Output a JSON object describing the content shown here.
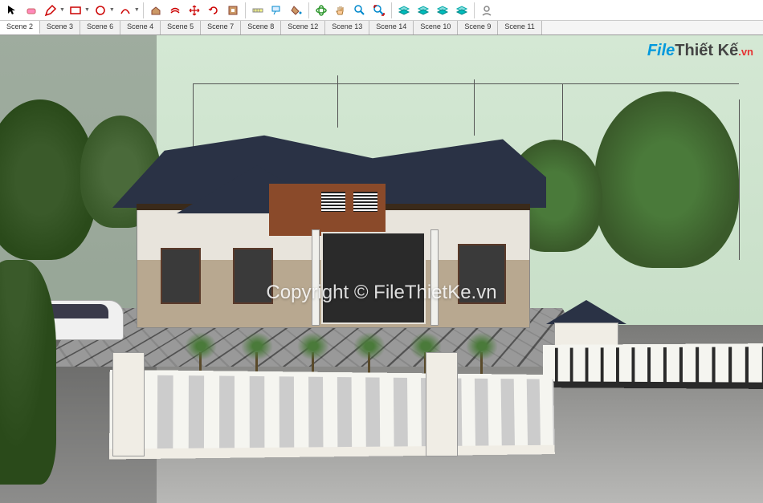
{
  "toolbar": {
    "tools": [
      {
        "name": "select-tool",
        "color": "#000"
      },
      {
        "name": "eraser-tool",
        "color": "#e88"
      },
      {
        "name": "pencil-tool",
        "color": "#c00",
        "hasDropdown": true
      },
      {
        "name": "rectangle-tool",
        "color": "#c00",
        "hasDropdown": true
      },
      {
        "name": "circle-tool",
        "color": "#c00",
        "hasDropdown": true
      },
      {
        "name": "arc-tool",
        "color": "#c00",
        "hasDropdown": true
      }
    ],
    "tools2": [
      {
        "name": "push-pull-tool",
        "color": "#a33"
      },
      {
        "name": "offset-tool",
        "color": "#c00"
      },
      {
        "name": "move-tool",
        "color": "#c00"
      },
      {
        "name": "rotate-tool",
        "color": "#c00"
      },
      {
        "name": "scale-tool",
        "color": "#a33"
      }
    ],
    "tools3": [
      {
        "name": "tape-measure-tool",
        "color": "#888"
      },
      {
        "name": "text-tool",
        "color": "#08c"
      },
      {
        "name": "paint-bucket-tool",
        "color": "#a73"
      }
    ],
    "tools4": [
      {
        "name": "orbit-tool",
        "color": "#393"
      },
      {
        "name": "pan-tool",
        "color": "#a73"
      },
      {
        "name": "zoom-tool",
        "color": "#08c"
      },
      {
        "name": "zoom-extents-tool",
        "color": "#c00"
      }
    ],
    "tools5": [
      {
        "name": "layer-tool-1",
        "color": "#0bb"
      },
      {
        "name": "layer-tool-2",
        "color": "#0bb"
      },
      {
        "name": "layer-tool-3",
        "color": "#0bb"
      },
      {
        "name": "layer-tool-4",
        "color": "#0bb"
      }
    ],
    "tools6": [
      {
        "name": "profile-tool",
        "color": "#888"
      }
    ]
  },
  "scenes": {
    "tabs": [
      {
        "label": "Scene 2",
        "active": true
      },
      {
        "label": "Scene 3",
        "active": false
      },
      {
        "label": "Scene 6",
        "active": false
      },
      {
        "label": "Scene 4",
        "active": false
      },
      {
        "label": "Scene 5",
        "active": false
      },
      {
        "label": "Scene 7",
        "active": false
      },
      {
        "label": "Scene 8",
        "active": false
      },
      {
        "label": "Scene 12",
        "active": false
      },
      {
        "label": "Scene 13",
        "active": false
      },
      {
        "label": "Scene 14",
        "active": false
      },
      {
        "label": "Scene 10",
        "active": false
      },
      {
        "label": "Scene 9",
        "active": false
      },
      {
        "label": "Scene 11",
        "active": false
      }
    ]
  },
  "watermark": {
    "brand_part1": "File",
    "brand_part2": "Thiết Kế",
    "brand_part3": ".vn",
    "copyright": "Copyright © FileThietKe.vn"
  },
  "viewport": {
    "scene_description": "3D architectural model of single-story house with hip roof, white fence, gate, car, trees, paved yard"
  }
}
